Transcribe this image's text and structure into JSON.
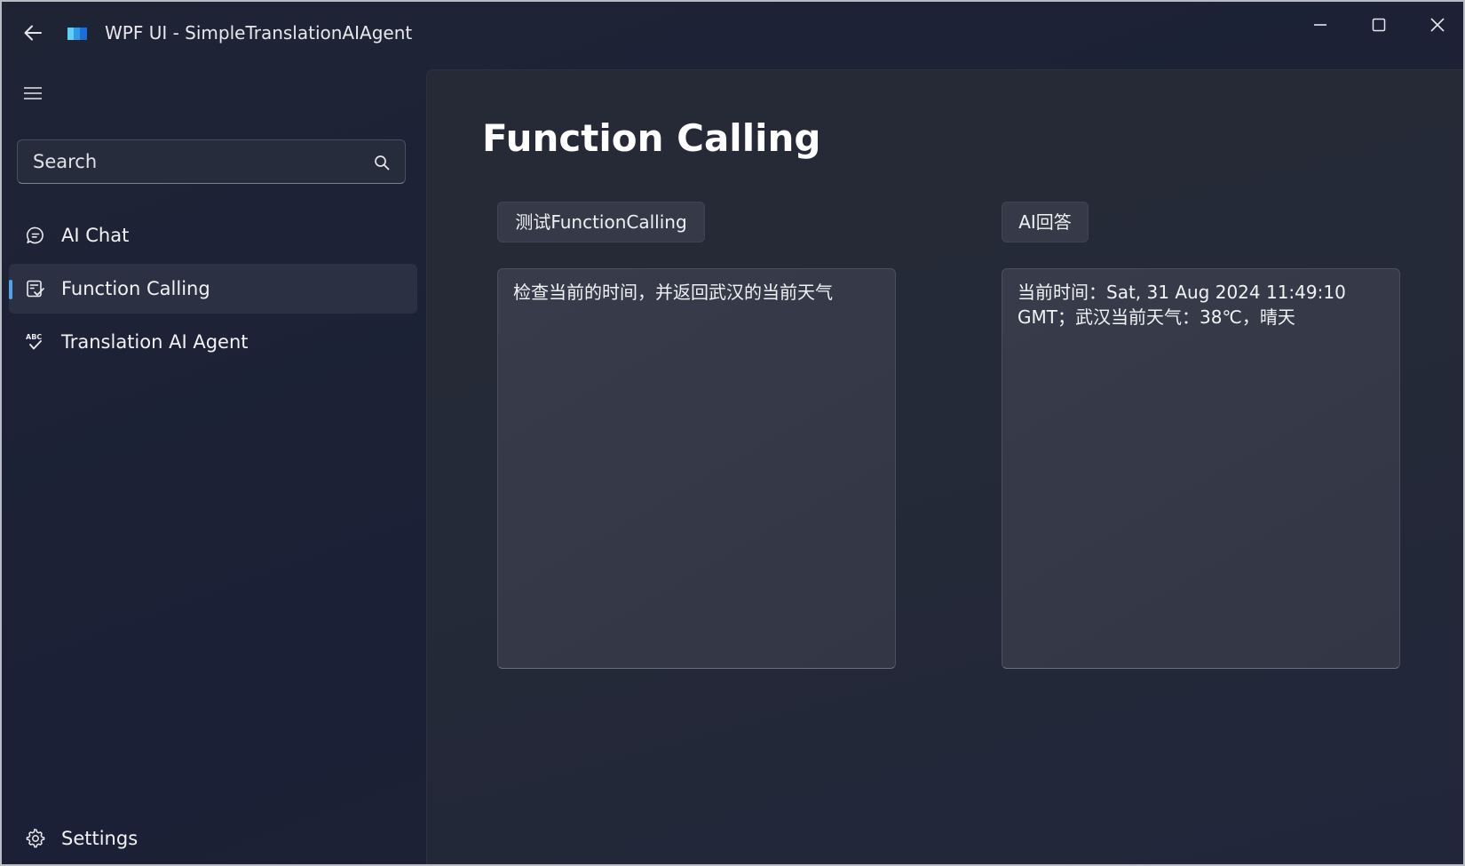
{
  "window": {
    "title": "WPF UI - SimpleTranslationAIAgent",
    "controls": {
      "minimize": "minimize",
      "maximize": "maximize",
      "close": "close"
    }
  },
  "sidebar": {
    "search": {
      "placeholder": "Search"
    },
    "items": [
      {
        "label": "AI Chat",
        "icon": "chat-bubble-icon",
        "active": false
      },
      {
        "label": "Function Calling",
        "icon": "function-form-icon",
        "active": true
      },
      {
        "label": "Translation AI Agent",
        "icon": "abc-spellcheck-icon",
        "active": false
      }
    ],
    "footer": {
      "label": "Settings",
      "icon": "gear-icon"
    }
  },
  "page": {
    "title": "Function Calling",
    "test_button": "测试FunctionCalling",
    "answer_button": "AI回答",
    "input_text": "检查当前的时间，并返回武汉的当前天气",
    "output_text": "当前时间：Sat, 31 Aug 2024 11:49:10 GMT；武汉当前天气：38℃，晴天"
  },
  "colors": {
    "accent": "#4fa3e8",
    "window_bg": "#1b2036",
    "content_bg": "#252a38",
    "panel_bg": "#363a48"
  }
}
